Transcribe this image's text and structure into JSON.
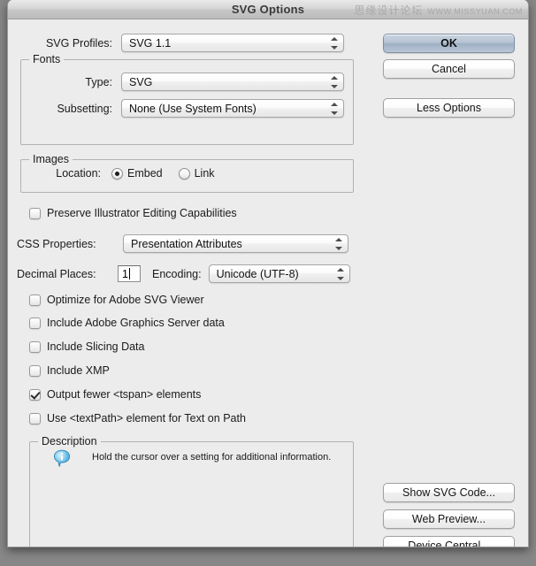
{
  "window": {
    "title": "SVG Options",
    "watermark_cn": "思缘设计论坛",
    "watermark_url": "WWW.MISSYUAN.COM"
  },
  "fields": {
    "svg_profiles": {
      "label": "SVG Profiles:",
      "value": "SVG 1.1"
    },
    "fonts_group": {
      "title": "Fonts"
    },
    "font_type": {
      "label": "Type:",
      "value": "SVG"
    },
    "font_subsetting": {
      "label": "Subsetting:",
      "value": "None (Use System Fonts)"
    },
    "images_group": {
      "title": "Images"
    },
    "image_location": {
      "label": "Location:",
      "selected": "Embed",
      "options": [
        "Embed",
        "Link"
      ]
    },
    "css_properties": {
      "label": "CSS Properties:",
      "value": "Presentation Attributes"
    },
    "decimal_places": {
      "label": "Decimal Places:",
      "value": "1"
    },
    "encoding": {
      "label": "Encoding:",
      "value": "Unicode (UTF-8)"
    }
  },
  "checkboxes": [
    {
      "label": "Preserve Illustrator Editing Capabilities",
      "checked": false
    },
    {
      "label": "Optimize for Adobe SVG Viewer",
      "checked": false
    },
    {
      "label": "Include Adobe Graphics Server data",
      "checked": false
    },
    {
      "label": "Include Slicing Data",
      "checked": false
    },
    {
      "label": "Include XMP",
      "checked": false
    },
    {
      "label": "Output fewer <tspan> elements",
      "checked": true
    },
    {
      "label": "Use <textPath> element for Text on Path",
      "checked": false
    }
  ],
  "description": {
    "title": "Description",
    "text": "Hold the cursor over a setting for additional information."
  },
  "buttons": {
    "ok": "OK",
    "cancel": "Cancel",
    "less_options": "Less Options",
    "show_svg_code": "Show SVG Code...",
    "web_preview": "Web Preview...",
    "device_central": "Device Central..."
  },
  "colors": {
    "dialog_bg": "#ececec",
    "default_button": "#b6c3d3",
    "info_icon": "#5bb8e8"
  }
}
